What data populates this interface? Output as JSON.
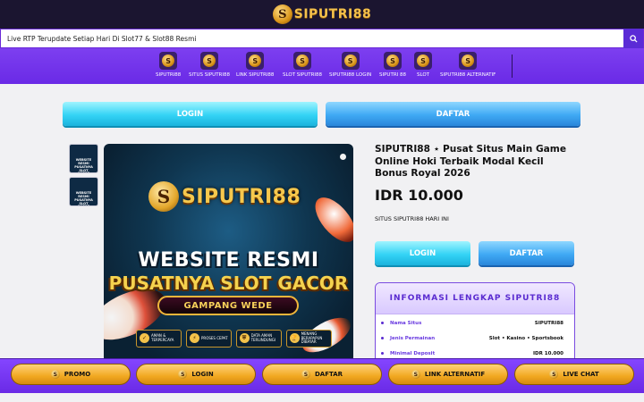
{
  "brand": {
    "logo_letter": "S",
    "logo_text": "SIPUTRI88"
  },
  "marquee": {
    "text": "Live RTP Terupdate Setiap Hari Di Slot77 & Slot88 Resmi",
    "search_icon": "search-icon"
  },
  "nav": {
    "items": [
      {
        "label": "SIPUTRI88",
        "icon": "S"
      },
      {
        "label": "SITUS SIPUTRI88",
        "icon": "S"
      },
      {
        "label": "LINK SIPUTRI88",
        "icon": "S"
      },
      {
        "label": "SLOT SIPUTRI88",
        "icon": "S"
      },
      {
        "label": "SIPUTRI88 LOGIN",
        "icon": "S"
      },
      {
        "label": "SIPUTRI 88",
        "icon": "S"
      },
      {
        "label": "SLOT",
        "icon": "S"
      },
      {
        "label": "SIPUTRI88 ALTERNATIF",
        "icon": "S"
      }
    ]
  },
  "top_buttons": {
    "login": "LOGIN",
    "daftar": "DAFTAR"
  },
  "hero": {
    "brand_letter": "S",
    "brand_text": "SIPUTRI88",
    "headline1": "WEBSITE RESMI",
    "headline2": "PUSATNYA SLOT GACOR",
    "ribbon": "GAMPANG WEDE",
    "features": [
      {
        "icon": "✓",
        "text": "AMAN & TERPERCAYA"
      },
      {
        "icon": "⚡",
        "text": "PROSES CEPAT"
      },
      {
        "icon": "⛨",
        "text": "DATA AMAN TERLINDUNGI"
      },
      {
        "icon": "🏆",
        "text": "MENANG BERAPAPUN DIBAYAR"
      }
    ]
  },
  "thumbs": [
    {
      "text": "WEBSITE RESMI PUSATNYA SLOT GACOR"
    },
    {
      "text": "WEBSITE RESMI PUSATNYA SLOT GACOR"
    }
  ],
  "product": {
    "title": "SIPUTRI88 ⋆ Pusat Situs Main Game Online Hoki Terbaik Modal Kecil Bonus Royal 2026",
    "price": "IDR 10.000",
    "subtitle": "SITUS SIPUTRI88 HARI INI",
    "login": "LOGIN",
    "daftar": "DAFTAR"
  },
  "info": {
    "title": "INFORMASI LENGKAP SIPUTRI88",
    "rows": [
      {
        "key": "Nama Situs",
        "value": "SIPUTRI88"
      },
      {
        "key": "Jenis Permainan",
        "value": "Slot • Kasino • Sportsbook"
      },
      {
        "key": "Minimal Deposit",
        "value": "IDR 10.000"
      }
    ]
  },
  "bottom": {
    "buttons": [
      {
        "label": "PROMO",
        "icon": "S"
      },
      {
        "label": "LOGIN",
        "icon": "S"
      },
      {
        "label": "DAFTAR",
        "icon": "S"
      },
      {
        "label": "LINK ALTERNATIF",
        "icon": "S"
      },
      {
        "label": "LIVE CHAT",
        "icon": "S"
      }
    ]
  }
}
